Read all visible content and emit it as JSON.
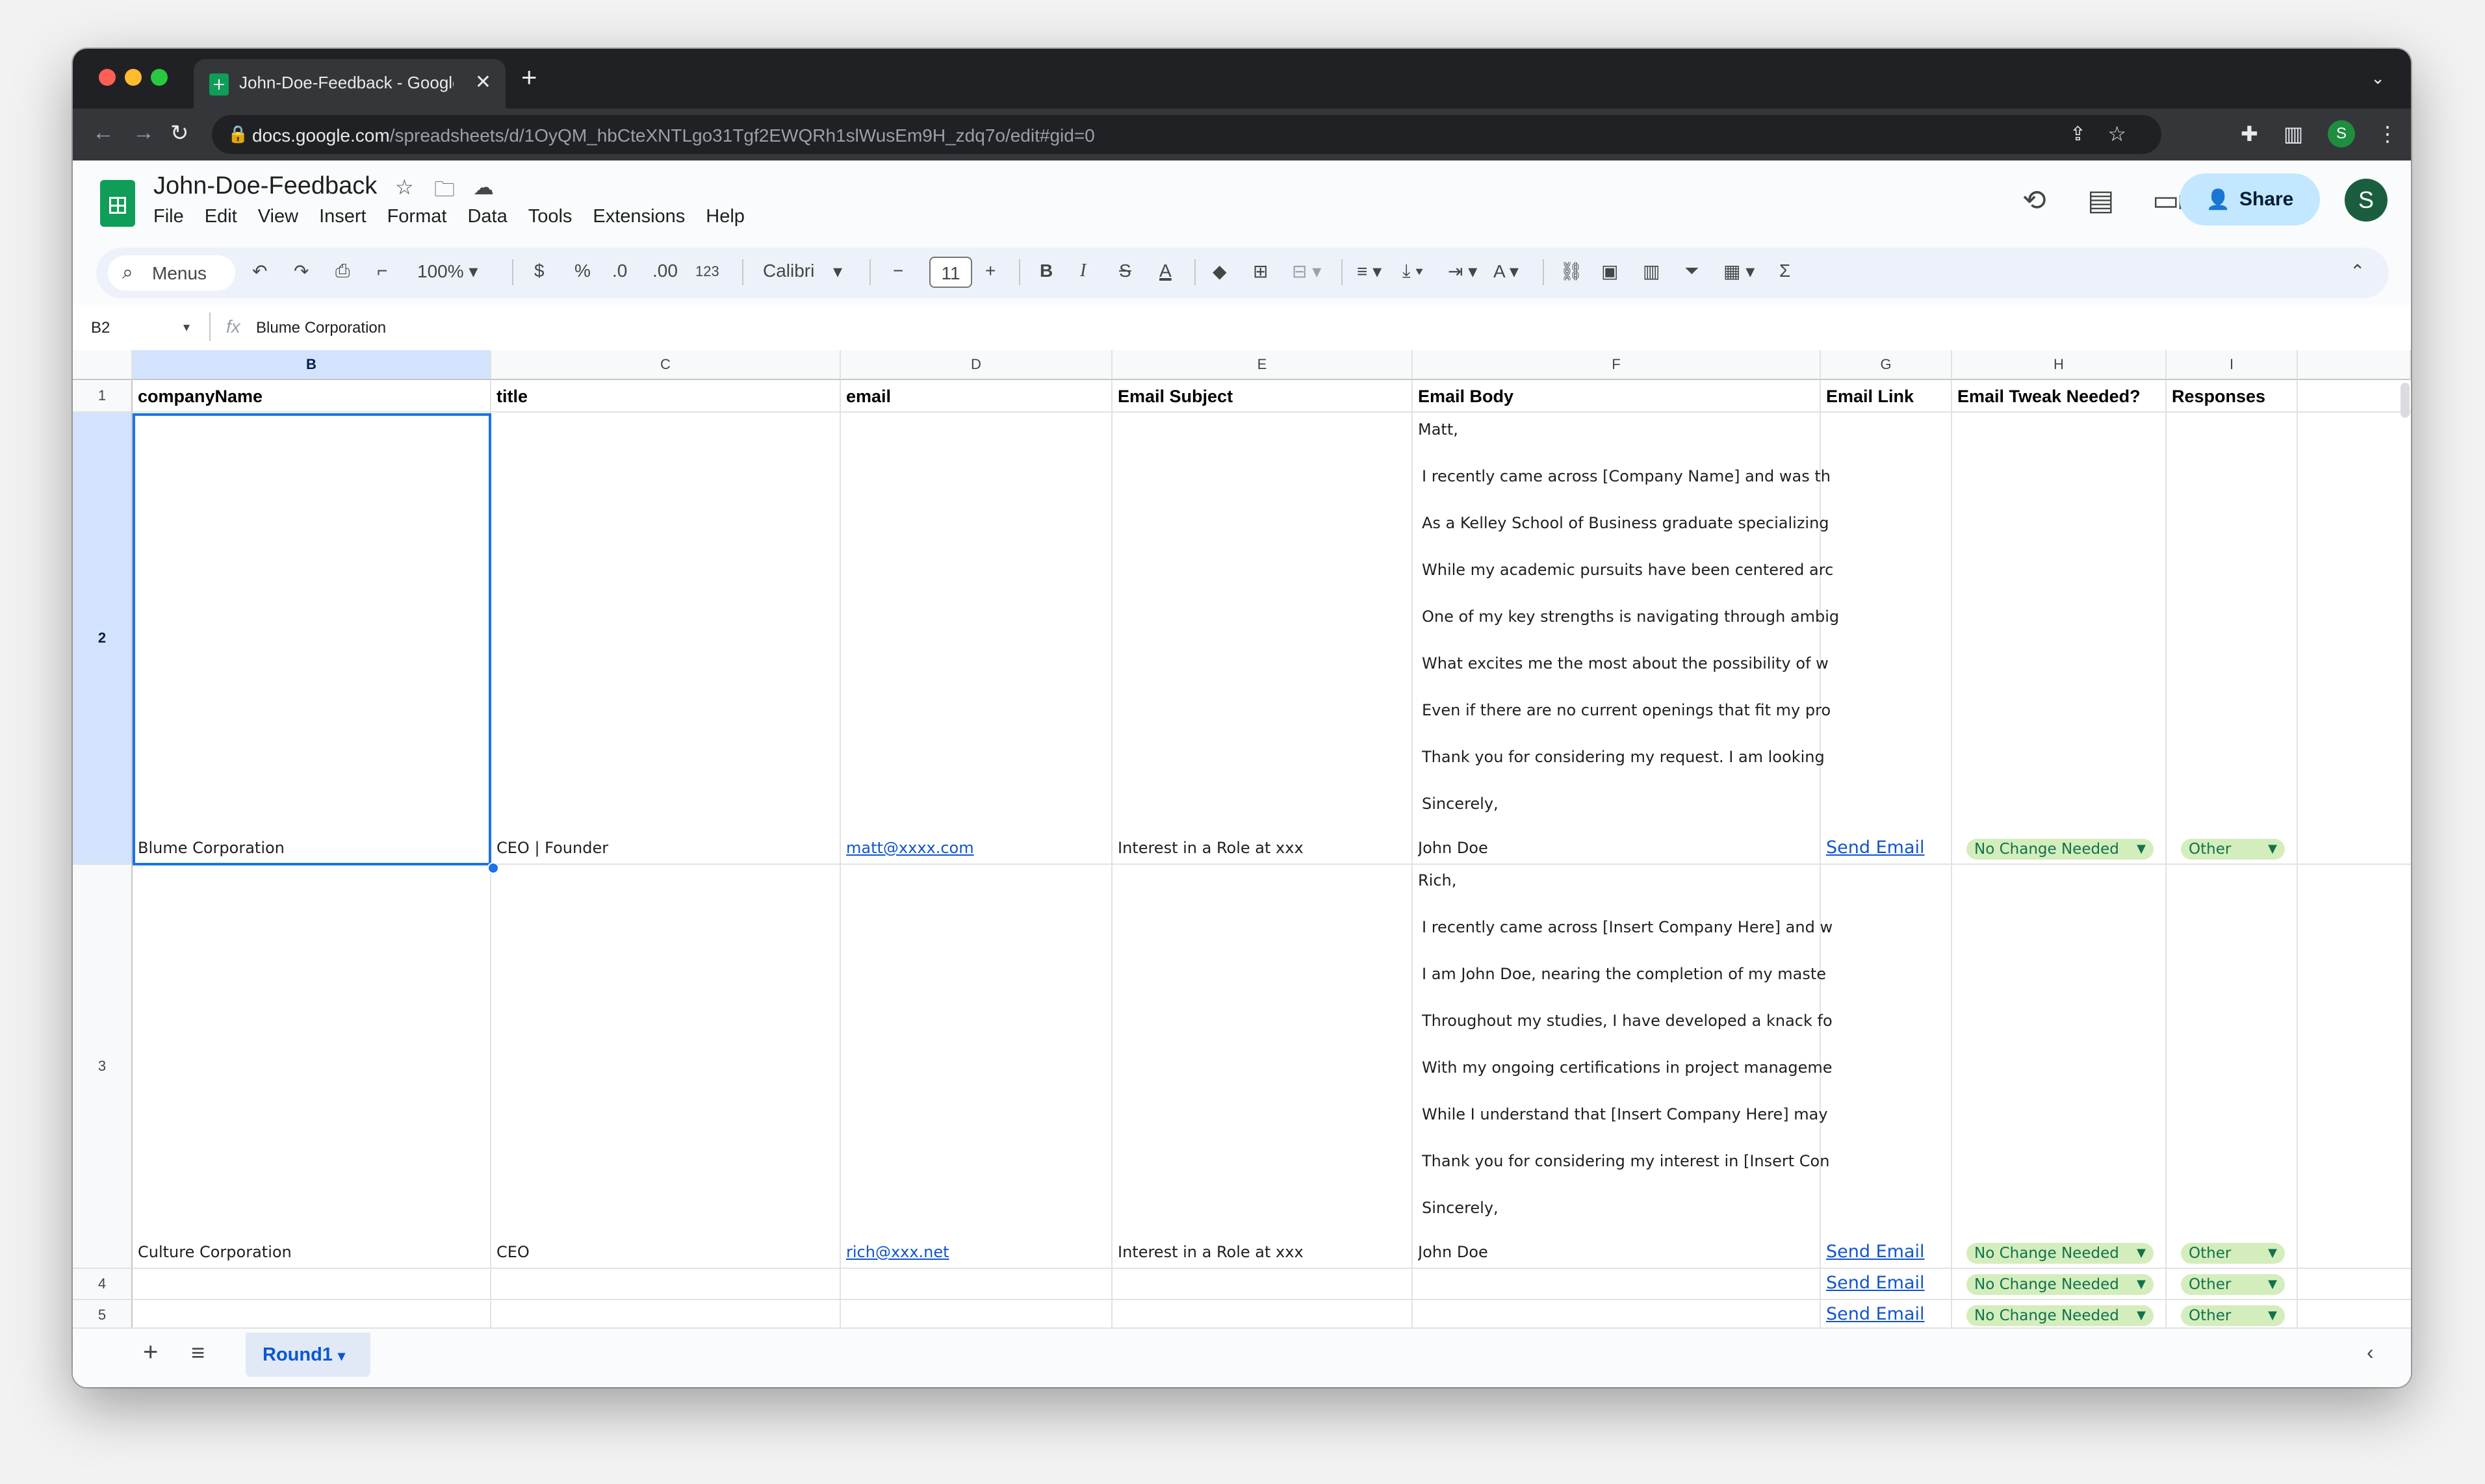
{
  "browser": {
    "tab_title": "John-Doe-Feedback - Google",
    "url_domain": "docs.google.com",
    "url_path": "/spreadsheets/d/1OyQM_hbCteXNTLgo31Tgf2EWQRh1slWusEm9H_zdq7o/edit#gid=0",
    "profile_initial": "S"
  },
  "app": {
    "title": "John-Doe-Feedback",
    "menu": [
      "File",
      "Edit",
      "View",
      "Insert",
      "Format",
      "Data",
      "Tools",
      "Extensions",
      "Help"
    ],
    "share_label": "Share",
    "avatar_initial": "S"
  },
  "toolbar": {
    "menus_label": "Menus",
    "zoom": "100%",
    "currency": "$",
    "percent": "%",
    "dec_decrease": ".0",
    "dec_increase": ".00",
    "number_format": "123",
    "font": "Calibri",
    "font_size": "11"
  },
  "formula_bar": {
    "cell_ref": "B2",
    "fx": "fx",
    "content": "Blume Corporation"
  },
  "columns": [
    "B",
    "C",
    "D",
    "E",
    "F",
    "G",
    "H",
    "I"
  ],
  "rows": [
    "1",
    "2",
    "3",
    "4",
    "5"
  ],
  "headers": {
    "companyName": "companyName",
    "title": "title",
    "email": "email",
    "subject": "Email Subject",
    "body": "Email Body",
    "link": "Email Link",
    "tweak": "Email Tweak Needed?",
    "responses": "Responses"
  },
  "records": [
    {
      "companyName": "Blume Corporation",
      "title": "CEO | Founder",
      "email": "matt@xxxx.com",
      "subject": "Interest in a Role at xxx",
      "body": [
        "Matt,",
        "I recently came across [Company Name] and was th",
        "As a Kelley School of Business graduate specializing",
        "While my academic pursuits have been centered arc",
        "One of my key strengths is navigating through ambig",
        "What excites me the most about the possibility of w",
        "Even if there are no current openings that fit my pro",
        "Thank you for considering my request. I am looking",
        "Sincerely,",
        "John Doe"
      ],
      "link": "Send Email",
      "tweak": "No Change Needed",
      "response": "Other"
    },
    {
      "companyName": "Culture Corporation",
      "title": "CEO",
      "email": "rich@xxx.net",
      "subject": "Interest in a Role at xxx",
      "body": [
        "Rich,",
        "I recently came across [Insert Company Here] and w",
        "I am John Doe, nearing the completion of my maste",
        "Throughout my studies, I have developed a knack fo",
        "With my ongoing certifications in project manageme",
        "While I understand that [Insert Company Here] may",
        "Thank you for considering my interest in [Insert Con",
        "Sincerely,",
        "John Doe"
      ],
      "link": "Send Email",
      "tweak": "No Change Needed",
      "response": "Other"
    },
    {
      "link": "Send Email",
      "tweak": "No Change Needed",
      "response": "Other"
    },
    {
      "link": "Send Email",
      "tweak": "No Change Needed",
      "response": "Other"
    }
  ],
  "sheet_tab": "Round1",
  "colors": {
    "chip_bg": "#d4edbc",
    "chip_text": "#11734b",
    "link": "#1155cc",
    "selection": "#1a73e8",
    "share_bg": "#c2e7ff"
  }
}
